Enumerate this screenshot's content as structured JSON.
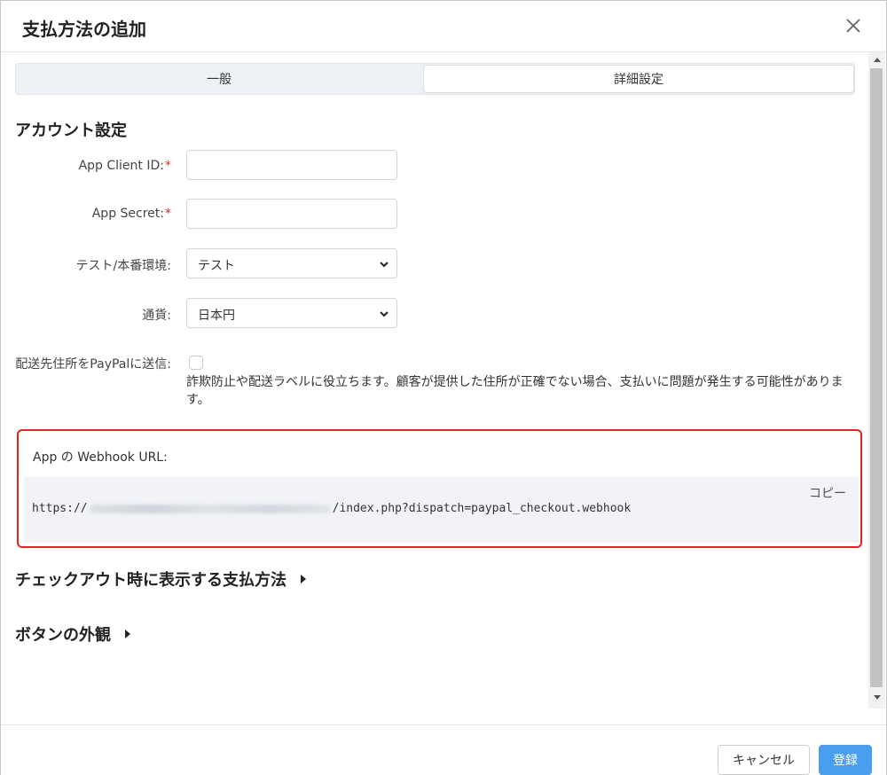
{
  "dialog": {
    "title": "支払方法の追加"
  },
  "tabs": [
    {
      "label": "一般",
      "active": false
    },
    {
      "label": "詳細設定",
      "active": true
    }
  ],
  "account": {
    "section_title": "アカウント設定",
    "client_id_label": "App Client ID:",
    "client_id_value": "",
    "secret_label": "App Secret:",
    "secret_value": "",
    "required_mark": "*",
    "env_label": "テスト/本番環境:",
    "env_value": "テスト",
    "currency_label": "通貨:",
    "currency_value": "日本円",
    "send_address_label": "配送先住所をPayPalに送信:",
    "send_address_checked": false,
    "send_address_help": "詐欺防止や配送ラベルに役立ちます。顧客が提供した住所が正確でない場合、支払いに問題が発生する可能性があります。"
  },
  "webhook": {
    "label": "App の Webhook URL:",
    "copy_label": "コピー",
    "url_prefix": "https://",
    "url_suffix": "/index.php?dispatch=paypal_checkout.webhook"
  },
  "sections": {
    "checkout_methods": "チェックアウト時に表示する支払方法",
    "button_appearance": "ボタンの外観"
  },
  "footer": {
    "cancel_label": "キャンセル",
    "submit_label": "登録"
  },
  "colors": {
    "accent": "#4a9ef0",
    "required": "#e03030",
    "highlight_border": "#e02424"
  }
}
